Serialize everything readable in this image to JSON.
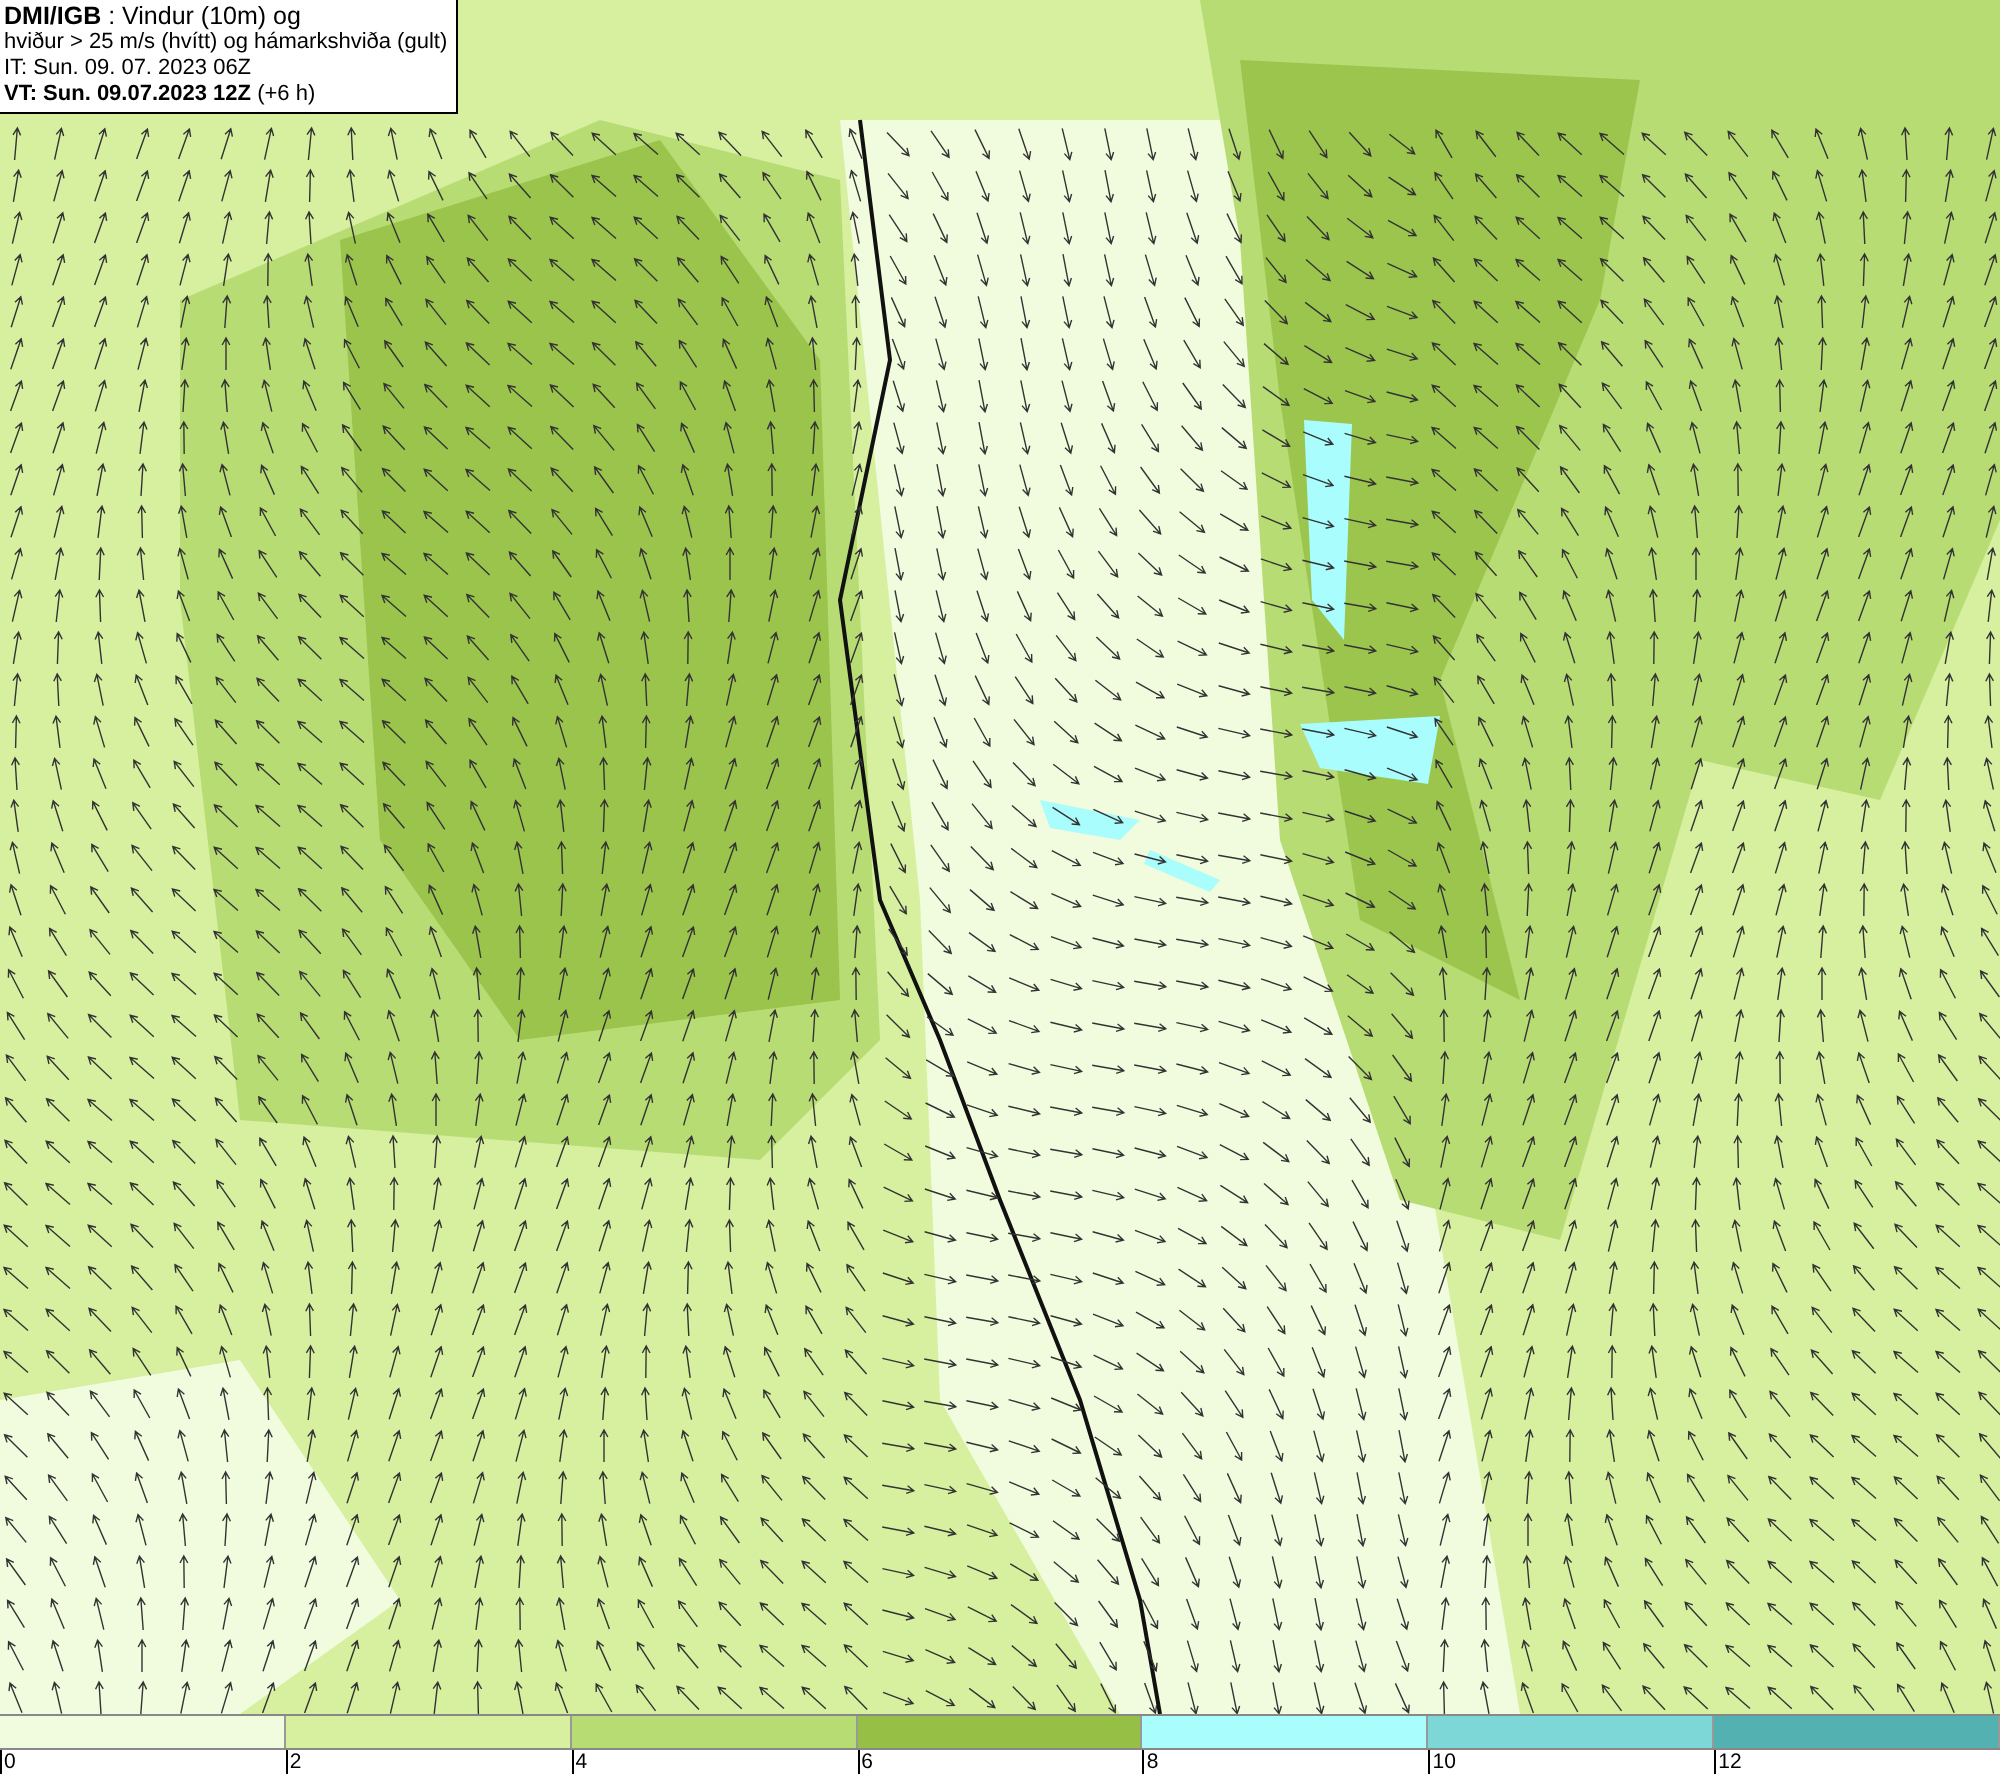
{
  "header": {
    "lines": [
      "**DMI/IGB** : Vindur (10m) og",
      "hviður > 25 m/s (hvítt) og hámarkshviða (gult)",
      "IT: Sun. 09. 07. 2023 06Z",
      "**VT: Sun. 09.07.2023 12Z** (+6 h)"
    ]
  },
  "colorbar": {
    "segments": [
      {
        "label": "0",
        "color": "#f1fbdd"
      },
      {
        "label": "2",
        "color": "#d6f09f"
      },
      {
        "label": "4",
        "color": "#b8dc74"
      },
      {
        "label": "6",
        "color": "#95bf45"
      },
      {
        "label": "8",
        "color": "#a9fdfd"
      },
      {
        "label": "10",
        "color": "#7ed7d7"
      },
      {
        "label": "12",
        "color": "#53b1b1"
      }
    ]
  }
}
